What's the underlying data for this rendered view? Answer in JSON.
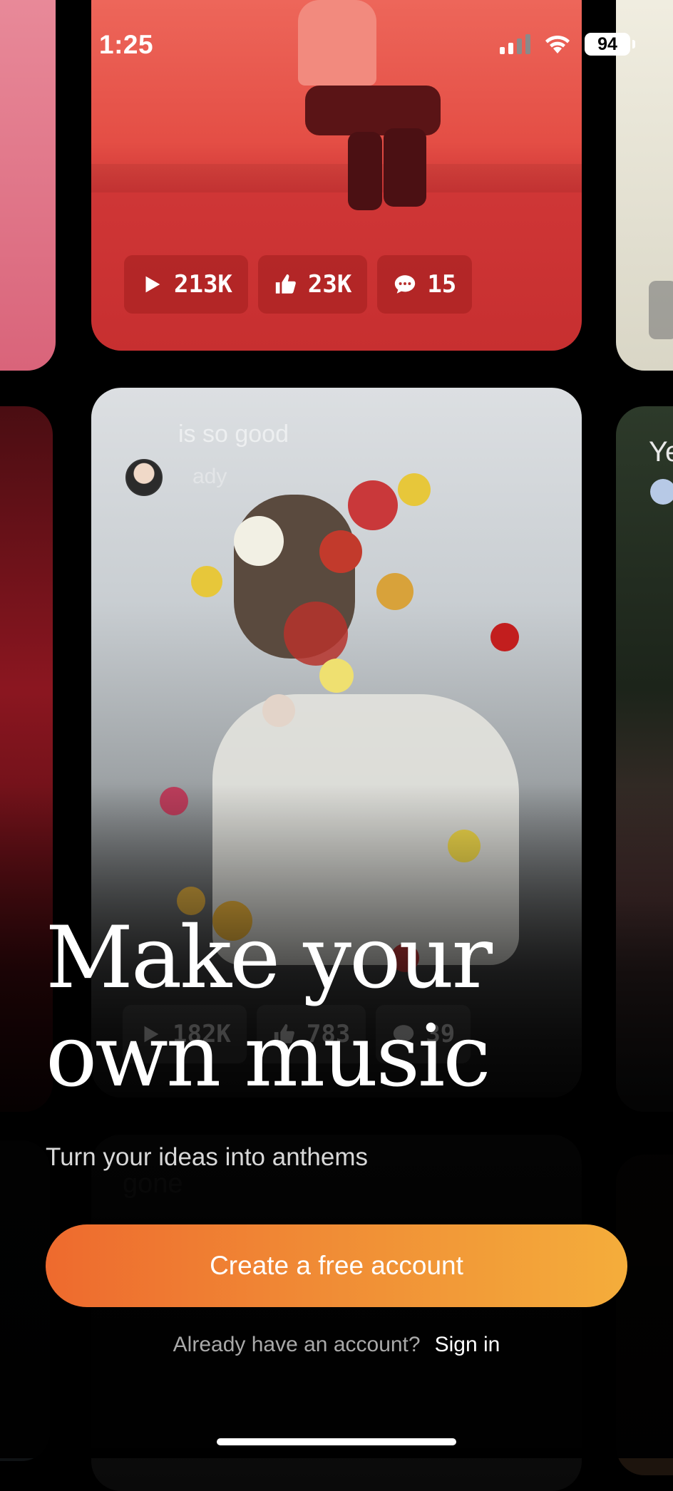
{
  "status_bar": {
    "time": "1:25",
    "battery": "94"
  },
  "feed": {
    "top_card": {
      "plays": "213K",
      "likes": "23K",
      "comments": "15"
    },
    "main_card": {
      "lyric_line_1": "is so good",
      "lyric_line_2": "ady",
      "plays": "182K",
      "likes": "783",
      "comments": "39"
    },
    "bottom_card": {
      "lyric": "gone"
    },
    "right_card": {
      "text": "Ye"
    }
  },
  "hero": {
    "headline_line_1": "Make your",
    "headline_line_2": "own music",
    "subtitle": "Turn your ideas into anthems"
  },
  "actions": {
    "create_account_label": "Create a free account",
    "signin_prompt": "Already have an account?",
    "signin_label": "Sign in"
  },
  "colors": {
    "cta_start": "#ee6a2e",
    "cta_end": "#f4ad3b",
    "background": "#000000"
  }
}
